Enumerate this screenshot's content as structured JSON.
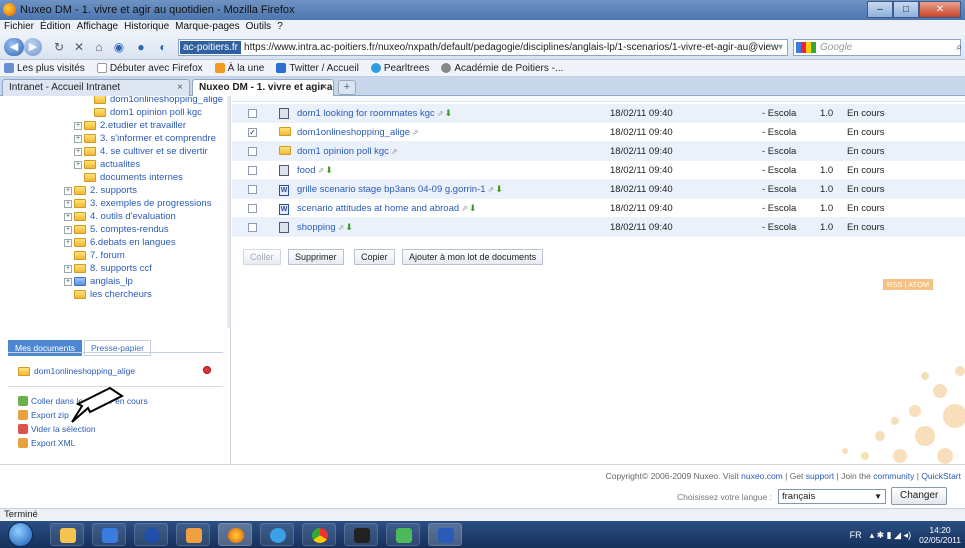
{
  "window": {
    "title": "Nuxeo DM - 1. vivre et agir au quotidien - Mozilla Firefox"
  },
  "menu": [
    "Fichier",
    "Édition",
    "Affichage",
    "Historique",
    "Marque-pages",
    "Outils",
    "?"
  ],
  "nav": {
    "site_badge": "ac-poitiers.fr",
    "url": "https://www.intra.ac-poitiers.fr/nuxeo/nxpath/default/pedagogie/disciplines/anglais-lp/1-scenarios/1-vivre-et-agir-au@view",
    "search_placeholder": "Google"
  },
  "bookmarks": [
    {
      "label": "Les plus visités",
      "color": "#6a8fd0"
    },
    {
      "label": "Débuter avec Firefox",
      "color": "#ffffff"
    },
    {
      "label": "À la une",
      "color": "#f49a1f"
    },
    {
      "label": "Twitter / Accueil",
      "color": "#2a6ed6"
    },
    {
      "label": "Pearltrees",
      "color": "#2a9de0"
    },
    {
      "label": "Académie de Poitiers -...",
      "color": "#888888"
    }
  ],
  "tabs": [
    {
      "label": "Intranet - Accueil Intranet",
      "active": false
    },
    {
      "label": "Nuxeo DM - 1. vivre et agir au qu...",
      "active": true
    }
  ],
  "tree": [
    {
      "label": "dom1onlineshopping_alige",
      "indent": 2,
      "expander": false
    },
    {
      "label": "dom1 opinion poll kgc",
      "indent": 2,
      "expander": false
    },
    {
      "label": "2.etudier et travailler",
      "indent": 1,
      "expander": true
    },
    {
      "label": "3. s'informer et comprendre",
      "indent": 1,
      "expander": true
    },
    {
      "label": "4. se cultiver et se divertir",
      "indent": 1,
      "expander": true
    },
    {
      "label": "actualites",
      "indent": 1,
      "expander": true
    },
    {
      "label": "documents internes",
      "indent": 1,
      "expander": false
    },
    {
      "label": "2. supports",
      "indent": 0,
      "expander": true
    },
    {
      "label": "3. exemples de progressions",
      "indent": 0,
      "expander": true
    },
    {
      "label": "4. outils d'evaluation",
      "indent": 0,
      "expander": true
    },
    {
      "label": "5. comptes-rendus",
      "indent": 0,
      "expander": true
    },
    {
      "label": "6.debats en langues",
      "indent": 0,
      "expander": true
    },
    {
      "label": "7. forum",
      "indent": 0,
      "expander": false
    },
    {
      "label": "8. supports ccf",
      "indent": 0,
      "expander": true
    },
    {
      "label": "anglais_lp",
      "indent": 0,
      "expander": true,
      "alt": true
    },
    {
      "label": "les chercheurs",
      "indent": 0,
      "expander": false
    }
  ],
  "panel": {
    "tab_active": "Mes documents",
    "tab_other": "Presse-papier",
    "doc_item": "dom1onlineshopping_alige",
    "actions": [
      {
        "label": "Coller dans le dossier en cours",
        "color": "#6ab04c"
      },
      {
        "label": "Export zip",
        "color": "#e6a23c"
      },
      {
        "label": "Vider la sélection",
        "color": "#d9534f"
      },
      {
        "label": "Export XML",
        "color": "#e6a23c"
      }
    ]
  },
  "documents": [
    {
      "name": "dom1 looking for roommates kgc",
      "icon": "doc",
      "checked": false,
      "date": "18/02/11 09:40",
      "author": "- Escola",
      "version": "1.0",
      "status": "En cours",
      "download": true
    },
    {
      "name": "dom1onlineshopping_alige",
      "icon": "folder",
      "checked": true,
      "date": "18/02/11 09:40",
      "author": "- Escola",
      "version": "",
      "status": "En cours",
      "download": false
    },
    {
      "name": "dom1 opinion poll kgc",
      "icon": "folder",
      "checked": false,
      "date": "18/02/11 09:40",
      "author": "- Escola",
      "version": "",
      "status": "En cours",
      "download": false
    },
    {
      "name": "food",
      "icon": "doc",
      "checked": false,
      "date": "18/02/11 09:40",
      "author": "- Escola",
      "version": "1.0",
      "status": "En cours",
      "download": true
    },
    {
      "name": "grille scenario stage bp3ans 04-09 g.gorrin-1",
      "icon": "word",
      "checked": false,
      "date": "18/02/11 09:40",
      "author": "- Escola",
      "version": "1.0",
      "status": "En cours",
      "download": true
    },
    {
      "name": "scenario attitudes at home and abroad",
      "icon": "word",
      "checked": false,
      "date": "18/02/11 09:40",
      "author": "- Escola",
      "version": "1.0",
      "status": "En cours",
      "download": true
    },
    {
      "name": "shopping",
      "icon": "doc",
      "checked": false,
      "date": "18/02/11 09:40",
      "author": "- Escola",
      "version": "1.0",
      "status": "En cours",
      "download": true
    }
  ],
  "buttons": {
    "coller": "Coller",
    "supprimer": "Supprimer",
    "copier": "Copier",
    "ajouter": "Ajouter à mon lot de documents"
  },
  "rss": "RSS | ATOM",
  "footer": {
    "copyright": "Copyright© 2006-2009 Nuxeo. Visit",
    "nuxeo_link": "nuxeo.com",
    "sep1": "| Get",
    "support_link": "support",
    "sep2": "| Join the",
    "community_link": "community",
    "sep3": "|",
    "quickstart_link": "QuickStart",
    "lang_label": "Choisissez votre langue :",
    "lang_value": "français",
    "change_button": "Changer"
  },
  "status": "Terminé",
  "tray": {
    "lang": "FR",
    "time": "14:20",
    "date": "02/05/2011"
  }
}
